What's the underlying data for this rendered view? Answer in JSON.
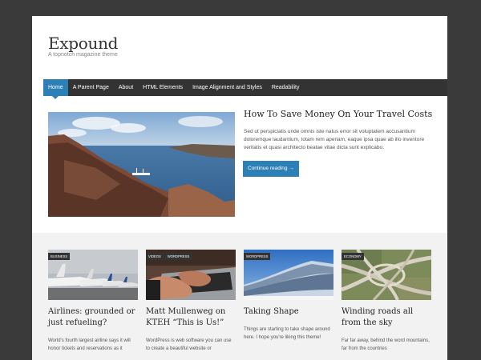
{
  "site": {
    "title": "Expound",
    "description": "A topnotch magazine theme"
  },
  "nav": {
    "items": [
      {
        "label": "Home"
      },
      {
        "label": "A Parent Page"
      },
      {
        "label": "About"
      },
      {
        "label": "HTML Elements"
      },
      {
        "label": "Image Alignment and Styles"
      },
      {
        "label": "Readability"
      }
    ],
    "active_index": 0
  },
  "featured": {
    "title": "How To Save Money On Your Travel Costs",
    "excerpt": "Sed ut perspiciatis unde omnis iste natus error sit voluptatem accusantium doloremque laudantium, totam rem aperiam, eaque ipsa quae ab illo inventore veritatis et quasi architecto beatae vitae dicta sunt explicabo.",
    "button_label": "Continue reading →"
  },
  "cards": [
    {
      "categories": [
        "BUSINESS"
      ],
      "title": "Airlines: grounded or just refueling?",
      "excerpt": "World's fourth largest airline says it will honor tickets and reservations as it"
    },
    {
      "categories": [
        "VIDEOS",
        "WORDPRESS"
      ],
      "title": "Matt Mullenweg on KTEH “This is Us!”",
      "excerpt": "WordPress is web software you can use to create a beautiful website or"
    },
    {
      "categories": [
        "WORDPRESS"
      ],
      "title": "Taking Shape",
      "excerpt": "Things are starting to take shape around here. I hope you're liking this theme!"
    },
    {
      "categories": [
        "ECONOMY"
      ],
      "title": "Winding roads all from the sky",
      "excerpt": "Far far away, behind the word mountains, far from the countries"
    }
  ],
  "colors": {
    "accent": "#2d80b6",
    "nav_bg": "#333333",
    "outer_bg": "#3a3a3a"
  }
}
